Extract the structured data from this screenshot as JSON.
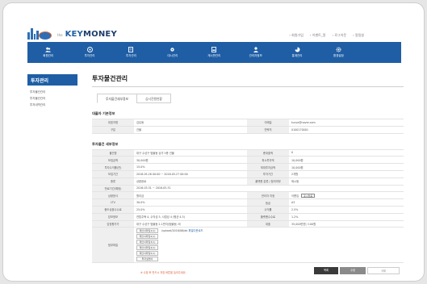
{
  "header": {
    "logo_prefix": "the",
    "brand_a": "KEY",
    "brand_b": "MONEY",
    "util_links": [
      "› 회원가입",
      "› 이벤트_알",
      "› 로그아웃",
      "› 알림설"
    ]
  },
  "nav": {
    "items": [
      {
        "label": "회원관리",
        "icon": "users-icon"
      },
      {
        "label": "투자관리",
        "icon": "coin-icon"
      },
      {
        "label": "투자관리",
        "icon": "document-icon"
      },
      {
        "label": "대시관리",
        "icon": "settings-gear-icon"
      },
      {
        "label": "게시판관리",
        "icon": "board-icon"
      },
      {
        "label": "관리자정보",
        "icon": "person-icon"
      },
      {
        "label": "통계관리",
        "icon": "chart-icon"
      },
      {
        "label": "환경설정",
        "icon": "gear-icon"
      }
    ]
  },
  "sidebar": {
    "title": "투자관리",
    "items": [
      "투자물건관리",
      "투자물건관리",
      "투자내역관리"
    ]
  },
  "main": {
    "title": "투자물건관리",
    "tabs": [
      "투자물건세부정보",
      "심사진행현황"
    ]
  },
  "borrower": {
    "title": "대출자 기본정보",
    "rows": [
      {
        "l1": "대표자명",
        "v1": "김유동",
        "l2": "이메일",
        "v2": "kurye@naver.com"
      },
      {
        "l1": "구분",
        "v1": "건물",
        "l2": "연락처",
        "v2": "0100170001"
      }
    ]
  },
  "detail": {
    "title": "투자물건 세부정보",
    "rows": [
      {
        "l1": "물건명",
        "v1": "대구 수성구 범물동 상가 5층 건물",
        "l2": "총대출액",
        "v2": "0"
      },
      {
        "l1": "모집금액",
        "v1": "30,000원",
        "l2": "최소투자액",
        "v2": "10,000원"
      },
      {
        "l1": "투자수익률(연)",
        "v1": "15.0%",
        "l2": "최대투자금액",
        "v2": "10,000원"
      },
      {
        "l1": "모집기간",
        "v1": "2016.05.26 00:00 ~ 2016.05.27 00:00",
        "l2": "투자기간",
        "v2": "2개월"
      },
      {
        "l1": "종류",
        "v1": "상환완료",
        "l2": "플랫폼 분류 / 참여여부",
        "v2": "제시됨"
      },
      {
        "l1": "만료기간(예정)",
        "v1": "2016.03.31 ~ 2016.05.31",
        "l2": "",
        "v2": ""
      },
      {
        "l1": "상환방식",
        "v1": "원리금",
        "l2": "관리자 지정",
        "v2": "이름입",
        "select": "표시없음"
      },
      {
        "l1": "LTV",
        "v1": "30.0%",
        "l2": "등급",
        "v2": "A3"
      },
      {
        "l1": "중도상환수수료",
        "v1": "25.0%",
        "l2": "수익률",
        "v2": "2.5%"
      },
      {
        "l1": "담보정보",
        "v1": "연립주택 4, 수익성 5, 사업성 4 (평균 4.3)",
        "l2": "플랫폼수수료",
        "v2": "1.2%"
      },
      {
        "l1": "감정평가가",
        "v1": "대구 수성구 범물동 2-1번지(범물동) 외",
        "l2": "대출",
        "v2": "35,000만원 / 100원"
      }
    ],
    "files_label": "첨부파일",
    "file_buttons": [
      "제안서파일1(1)",
      "제안서파일2(1)",
      "제안서파일3(1)",
      "제안서파일4(1)",
      "제안서파일5(1)",
      "투자설명서"
    ],
    "file_path": "/upload/2016/06/ab",
    "file_link": "파일다운로드"
  },
  "footer": {
    "note": "※ 수정 후 반드시 저장 버튼을 눌러주세요.",
    "buttons": [
      "목록",
      "수정",
      "삭제"
    ]
  },
  "colors": {
    "accent": "#1f5ea5",
    "brand_orange": "#e46a2c",
    "frame_bg": "#ffffff",
    "page_bg": "#e6e6e6"
  }
}
